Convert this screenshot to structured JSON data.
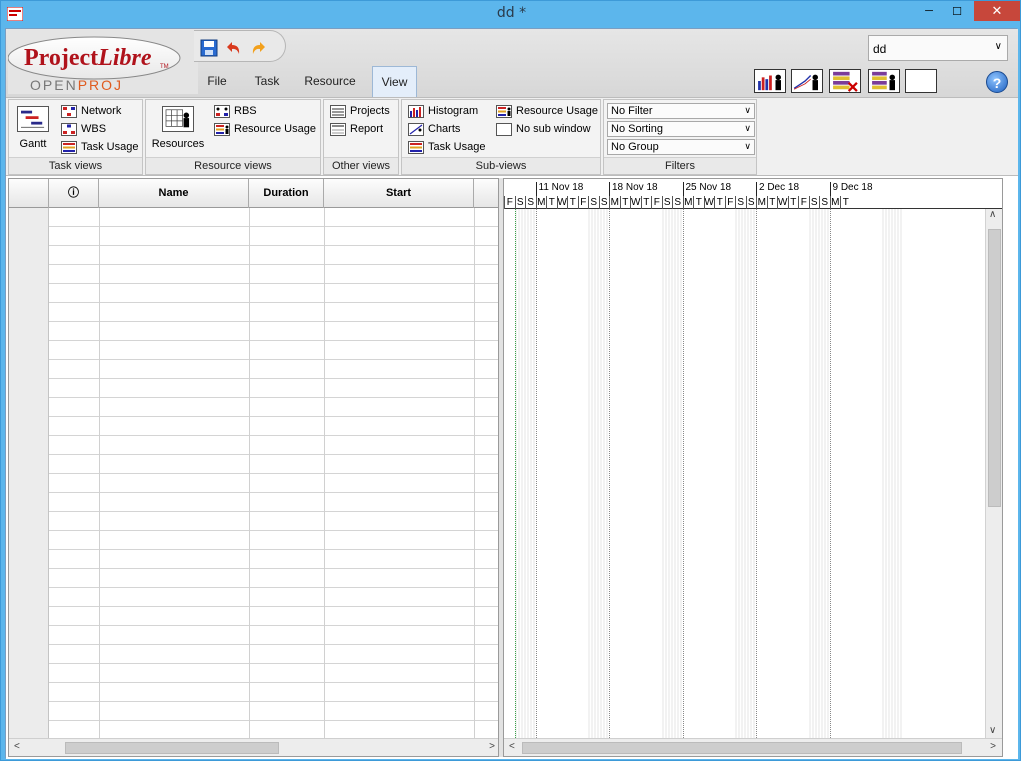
{
  "window": {
    "title": "dd *",
    "app_icon": "projectlibre-app-icon",
    "controls": {
      "minimize": "─",
      "maximize": "☐",
      "close": "✕"
    }
  },
  "logo": {
    "brand": "ProjectLibre",
    "tm": "TM",
    "sub": "OPENPROJ"
  },
  "quick_access": [
    {
      "name": "save-icon"
    },
    {
      "name": "undo-icon"
    },
    {
      "name": "redo-icon"
    }
  ],
  "menu": {
    "tabs": [
      {
        "label": "File",
        "active": false
      },
      {
        "label": "Task",
        "active": false
      },
      {
        "label": "Resource",
        "active": false
      },
      {
        "label": "View",
        "active": true
      }
    ]
  },
  "project_selector": {
    "value": "dd"
  },
  "toolbar_icons": [
    "resource-histogram-icon",
    "resource-chart-icon",
    "remove-filter-icon",
    "resource-grid-icon",
    "blank-box"
  ],
  "help": {
    "label": "?"
  },
  "ribbon": {
    "task_views": {
      "label": "Task views",
      "gantt": "Gantt",
      "network": "Network",
      "wbs": "WBS",
      "task_usage": "Task Usage"
    },
    "resource_views": {
      "label": "Resource views",
      "resources": "Resources",
      "rbs": "RBS",
      "resource_usage": "Resource Usage"
    },
    "other_views": {
      "label": "Other views",
      "projects": "Projects",
      "report": "Report"
    },
    "sub_views": {
      "label": "Sub-views",
      "histogram": "Histogram",
      "charts": "Charts",
      "task_usage": "Task Usage",
      "resource_usage": "Resource Usage",
      "no_sub_window": "No sub window"
    },
    "filters": {
      "label": "Filters",
      "filter": "No Filter",
      "sorting": "No Sorting",
      "group": "No Group"
    }
  },
  "grid": {
    "columns": [
      {
        "key": "row",
        "label": ""
      },
      {
        "key": "info",
        "label": "ⓘ"
      },
      {
        "key": "name",
        "label": "Name"
      },
      {
        "key": "duration",
        "label": "Duration"
      },
      {
        "key": "start",
        "label": "Start"
      },
      {
        "key": "more",
        "label": ""
      }
    ],
    "row_count": 28
  },
  "gantt": {
    "weeks": [
      "11 Nov 18",
      "18 Nov 18",
      "25 Nov 18",
      "2 Dec 18",
      "9 Dec 18"
    ],
    "leading_days": [
      "F",
      "S",
      "S"
    ],
    "week_days": [
      "M",
      "T",
      "W",
      "T",
      "F",
      "S",
      "S"
    ],
    "trailing_days": [
      "M",
      "T"
    ]
  },
  "colors": {
    "titlebar": "#5cb6ec",
    "close": "#c7473b",
    "active_tab": "#e4eefa",
    "today_line": "#3aa34a"
  }
}
